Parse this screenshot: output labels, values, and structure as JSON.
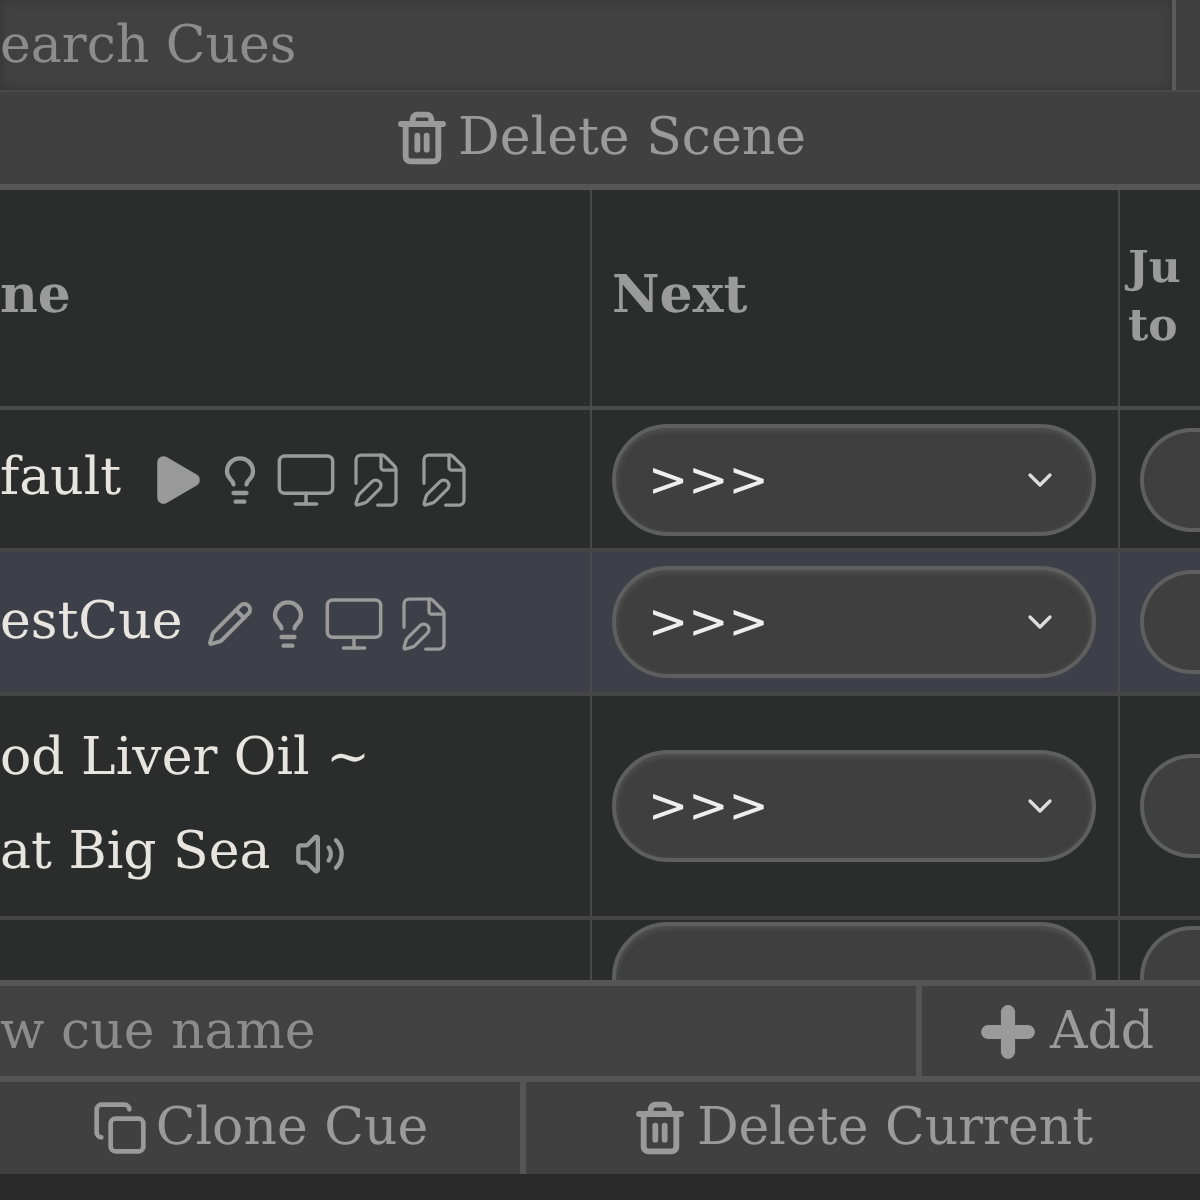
{
  "search": {
    "placeholder": "earch Cues"
  },
  "delete_scene": {
    "label": "Delete Scene"
  },
  "table": {
    "columns": [
      {
        "label": [
          "ne"
        ]
      },
      {
        "label": [
          "Next"
        ]
      },
      {
        "label": [
          "Ju",
          "to"
        ]
      }
    ],
    "rows": [
      {
        "name": [
          "fault"
        ],
        "selected": false,
        "icons": [
          {
            "kind": "play"
          },
          {
            "kind": "light"
          },
          {
            "kind": "screen"
          },
          {
            "kind": "notes"
          },
          {
            "kind": "notes"
          }
        ],
        "next": ">>>"
      },
      {
        "name": [
          "estCue"
        ],
        "selected": true,
        "icons": [
          {
            "kind": "edit"
          },
          {
            "kind": "light"
          },
          {
            "kind": "screen"
          },
          {
            "kind": "notes"
          }
        ],
        "next": ">>>"
      },
      {
        "name": [
          "od Liver Oil ~",
          "at Big Sea"
        ],
        "selected": false,
        "icons": [
          {
            "kind": "sound"
          }
        ],
        "next": ">>>"
      },
      {
        "name": [],
        "selected": false,
        "icons": []
      }
    ]
  },
  "new_cue": {
    "placeholder": "w cue name",
    "add_label": "Add"
  },
  "actions": [
    {
      "kind": "clone",
      "label": "Clone Cue"
    },
    {
      "kind": "delete",
      "label": "Delete Current"
    }
  ]
}
